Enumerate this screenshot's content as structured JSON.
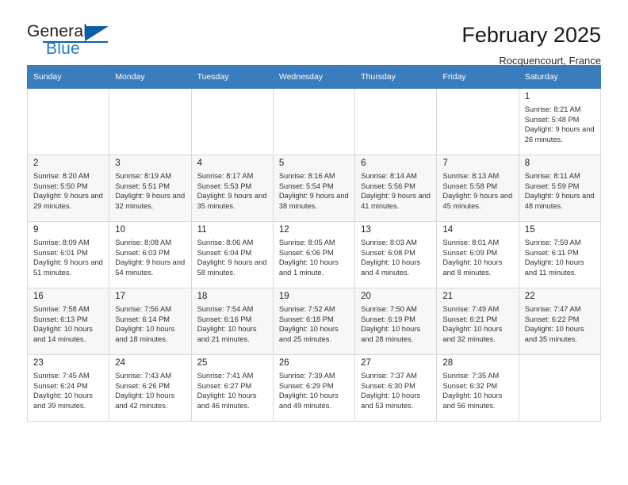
{
  "brand": {
    "name_part1": "General",
    "name_part2": "Blue",
    "accent_color": "#1f7dc4",
    "triangle_color": "#0b5ea8",
    "logo_icon": "triangle-flag-icon"
  },
  "header": {
    "title": "February 2025",
    "subtitle": "Rocquencourt, France"
  },
  "theme": {
    "header_row_bg": "#3a7dbf",
    "header_row_text": "#ffffff",
    "shaded_row_bg": "#f7f7f7",
    "grid_border": "#d9d9d9"
  },
  "weekdays": [
    "Sunday",
    "Monday",
    "Tuesday",
    "Wednesday",
    "Thursday",
    "Friday",
    "Saturday"
  ],
  "weeks": [
    {
      "shaded": false,
      "days": [
        {
          "empty": true
        },
        {
          "empty": true
        },
        {
          "empty": true
        },
        {
          "empty": true
        },
        {
          "empty": true
        },
        {
          "empty": true
        },
        {
          "empty": false,
          "num": "1",
          "sunrise": "Sunrise: 8:21 AM",
          "sunset": "Sunset: 5:48 PM",
          "daylight": "Daylight: 9 hours and 26 minutes."
        }
      ]
    },
    {
      "shaded": true,
      "days": [
        {
          "empty": false,
          "num": "2",
          "sunrise": "Sunrise: 8:20 AM",
          "sunset": "Sunset: 5:50 PM",
          "daylight": "Daylight: 9 hours and 29 minutes."
        },
        {
          "empty": false,
          "num": "3",
          "sunrise": "Sunrise: 8:19 AM",
          "sunset": "Sunset: 5:51 PM",
          "daylight": "Daylight: 9 hours and 32 minutes."
        },
        {
          "empty": false,
          "num": "4",
          "sunrise": "Sunrise: 8:17 AM",
          "sunset": "Sunset: 5:53 PM",
          "daylight": "Daylight: 9 hours and 35 minutes."
        },
        {
          "empty": false,
          "num": "5",
          "sunrise": "Sunrise: 8:16 AM",
          "sunset": "Sunset: 5:54 PM",
          "daylight": "Daylight: 9 hours and 38 minutes."
        },
        {
          "empty": false,
          "num": "6",
          "sunrise": "Sunrise: 8:14 AM",
          "sunset": "Sunset: 5:56 PM",
          "daylight": "Daylight: 9 hours and 41 minutes."
        },
        {
          "empty": false,
          "num": "7",
          "sunrise": "Sunrise: 8:13 AM",
          "sunset": "Sunset: 5:58 PM",
          "daylight": "Daylight: 9 hours and 45 minutes."
        },
        {
          "empty": false,
          "num": "8",
          "sunrise": "Sunrise: 8:11 AM",
          "sunset": "Sunset: 5:59 PM",
          "daylight": "Daylight: 9 hours and 48 minutes."
        }
      ]
    },
    {
      "shaded": false,
      "days": [
        {
          "empty": false,
          "num": "9",
          "sunrise": "Sunrise: 8:09 AM",
          "sunset": "Sunset: 6:01 PM",
          "daylight": "Daylight: 9 hours and 51 minutes."
        },
        {
          "empty": false,
          "num": "10",
          "sunrise": "Sunrise: 8:08 AM",
          "sunset": "Sunset: 6:03 PM",
          "daylight": "Daylight: 9 hours and 54 minutes."
        },
        {
          "empty": false,
          "num": "11",
          "sunrise": "Sunrise: 8:06 AM",
          "sunset": "Sunset: 6:04 PM",
          "daylight": "Daylight: 9 hours and 58 minutes."
        },
        {
          "empty": false,
          "num": "12",
          "sunrise": "Sunrise: 8:05 AM",
          "sunset": "Sunset: 6:06 PM",
          "daylight": "Daylight: 10 hours and 1 minute."
        },
        {
          "empty": false,
          "num": "13",
          "sunrise": "Sunrise: 8:03 AM",
          "sunset": "Sunset: 6:08 PM",
          "daylight": "Daylight: 10 hours and 4 minutes."
        },
        {
          "empty": false,
          "num": "14",
          "sunrise": "Sunrise: 8:01 AM",
          "sunset": "Sunset: 6:09 PM",
          "daylight": "Daylight: 10 hours and 8 minutes."
        },
        {
          "empty": false,
          "num": "15",
          "sunrise": "Sunrise: 7:59 AM",
          "sunset": "Sunset: 6:11 PM",
          "daylight": "Daylight: 10 hours and 11 minutes."
        }
      ]
    },
    {
      "shaded": true,
      "days": [
        {
          "empty": false,
          "num": "16",
          "sunrise": "Sunrise: 7:58 AM",
          "sunset": "Sunset: 6:13 PM",
          "daylight": "Daylight: 10 hours and 14 minutes."
        },
        {
          "empty": false,
          "num": "17",
          "sunrise": "Sunrise: 7:56 AM",
          "sunset": "Sunset: 6:14 PM",
          "daylight": "Daylight: 10 hours and 18 minutes."
        },
        {
          "empty": false,
          "num": "18",
          "sunrise": "Sunrise: 7:54 AM",
          "sunset": "Sunset: 6:16 PM",
          "daylight": "Daylight: 10 hours and 21 minutes."
        },
        {
          "empty": false,
          "num": "19",
          "sunrise": "Sunrise: 7:52 AM",
          "sunset": "Sunset: 6:18 PM",
          "daylight": "Daylight: 10 hours and 25 minutes."
        },
        {
          "empty": false,
          "num": "20",
          "sunrise": "Sunrise: 7:50 AM",
          "sunset": "Sunset: 6:19 PM",
          "daylight": "Daylight: 10 hours and 28 minutes."
        },
        {
          "empty": false,
          "num": "21",
          "sunrise": "Sunrise: 7:49 AM",
          "sunset": "Sunset: 6:21 PM",
          "daylight": "Daylight: 10 hours and 32 minutes."
        },
        {
          "empty": false,
          "num": "22",
          "sunrise": "Sunrise: 7:47 AM",
          "sunset": "Sunset: 6:22 PM",
          "daylight": "Daylight: 10 hours and 35 minutes."
        }
      ]
    },
    {
      "shaded": false,
      "days": [
        {
          "empty": false,
          "num": "23",
          "sunrise": "Sunrise: 7:45 AM",
          "sunset": "Sunset: 6:24 PM",
          "daylight": "Daylight: 10 hours and 39 minutes."
        },
        {
          "empty": false,
          "num": "24",
          "sunrise": "Sunrise: 7:43 AM",
          "sunset": "Sunset: 6:26 PM",
          "daylight": "Daylight: 10 hours and 42 minutes."
        },
        {
          "empty": false,
          "num": "25",
          "sunrise": "Sunrise: 7:41 AM",
          "sunset": "Sunset: 6:27 PM",
          "daylight": "Daylight: 10 hours and 46 minutes."
        },
        {
          "empty": false,
          "num": "26",
          "sunrise": "Sunrise: 7:39 AM",
          "sunset": "Sunset: 6:29 PM",
          "daylight": "Daylight: 10 hours and 49 minutes."
        },
        {
          "empty": false,
          "num": "27",
          "sunrise": "Sunrise: 7:37 AM",
          "sunset": "Sunset: 6:30 PM",
          "daylight": "Daylight: 10 hours and 53 minutes."
        },
        {
          "empty": false,
          "num": "28",
          "sunrise": "Sunrise: 7:35 AM",
          "sunset": "Sunset: 6:32 PM",
          "daylight": "Daylight: 10 hours and 56 minutes."
        },
        {
          "empty": true
        }
      ]
    }
  ]
}
